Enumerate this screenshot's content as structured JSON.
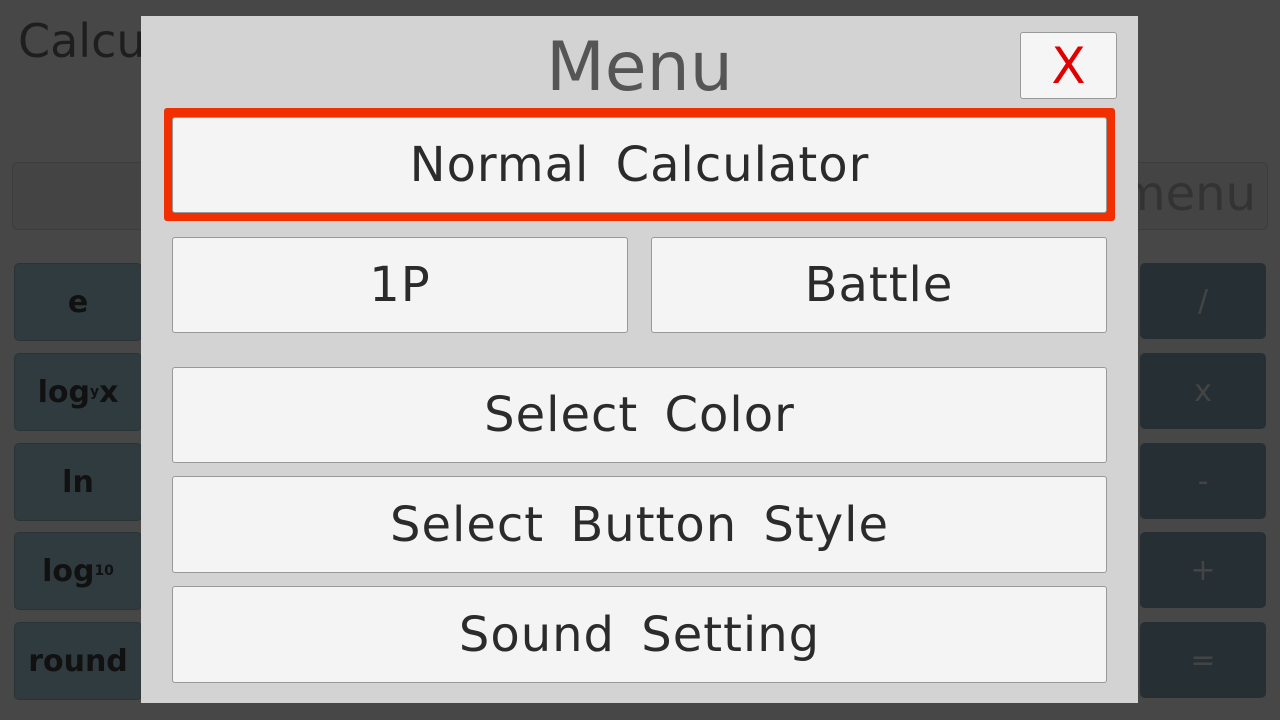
{
  "app": {
    "title": "Calculator",
    "menu_label": "menu"
  },
  "left_keys": [
    {
      "label": "e"
    },
    {
      "label": "log",
      "sub": "y",
      "suffix": "x"
    },
    {
      "label": "ln"
    },
    {
      "label": "log",
      "sub": "10",
      "suffix": ""
    },
    {
      "label": "round"
    }
  ],
  "right_keys": [
    {
      "label": "/"
    },
    {
      "label": "x"
    },
    {
      "label": "-"
    },
    {
      "label": "+"
    },
    {
      "label": "="
    }
  ],
  "dialog": {
    "title": "Menu",
    "close_label": "X",
    "normal_calculator": "Normal Calculator",
    "one_player": "1P",
    "battle": "Battle",
    "select_color": "Select Color",
    "select_button_style": "Select Button Style",
    "sound_setting": "Sound Setting"
  },
  "colors": {
    "highlight": "#f22f00",
    "close": "#e00000"
  }
}
